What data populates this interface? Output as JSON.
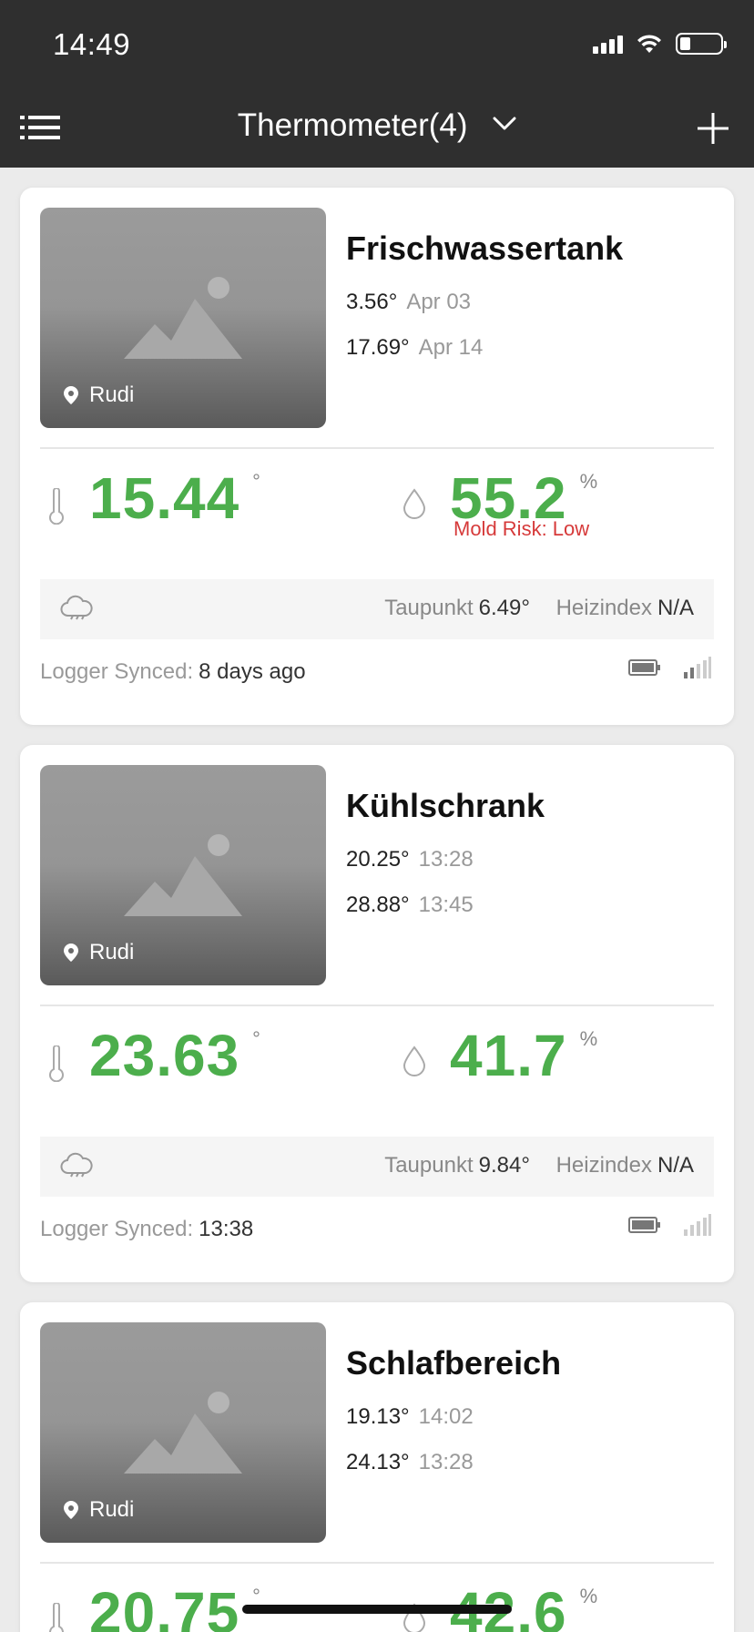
{
  "status_bar": {
    "time": "14:49"
  },
  "nav": {
    "title": "Thermometer(4)"
  },
  "cards": [
    {
      "name": "Frischwassertank",
      "location": "Rudi",
      "min": {
        "value": "3.56°",
        "time": "Apr 03"
      },
      "max": {
        "value": "17.69°",
        "time": "Apr 14"
      },
      "temperature": "15.44",
      "temp_unit": "°",
      "humidity": "55.2",
      "humidity_unit": "%",
      "mold_risk": "Mold Risk: Low",
      "dew_label": "Taupunkt",
      "dew_value": "6.49°",
      "heat_label": "Heizindex",
      "heat_value": "N/A",
      "synced_label": "Logger Synced:",
      "synced_value": "8 days ago"
    },
    {
      "name": "Kühlschrank",
      "location": "Rudi",
      "min": {
        "value": "20.25°",
        "time": "13:28"
      },
      "max": {
        "value": "28.88°",
        "time": "13:45"
      },
      "temperature": "23.63",
      "temp_unit": "°",
      "humidity": "41.7",
      "humidity_unit": "%",
      "dew_label": "Taupunkt",
      "dew_value": "9.84°",
      "heat_label": "Heizindex",
      "heat_value": "N/A",
      "synced_label": "Logger Synced:",
      "synced_value": "13:38"
    },
    {
      "name": "Schlafbereich",
      "location": "Rudi",
      "min": {
        "value": "19.13°",
        "time": "14:02"
      },
      "max": {
        "value": "24.13°",
        "time": "13:28"
      },
      "temperature": "20.75",
      "temp_unit": "°",
      "humidity": "42.6",
      "humidity_unit": "%"
    }
  ],
  "colors": {
    "header_bg": "#2f2f2f",
    "value_green": "#4cae4c",
    "mold_red": "#d63a3a"
  },
  "icons": {
    "menu": "list-icon",
    "dropdown": "chevron-down-icon",
    "add": "plus-icon",
    "location": "map-pin-icon",
    "temperature": "thermometer-icon",
    "humidity": "droplet-icon",
    "weather": "cloud-icon",
    "battery": "battery-icon",
    "signal": "signal-icon"
  }
}
